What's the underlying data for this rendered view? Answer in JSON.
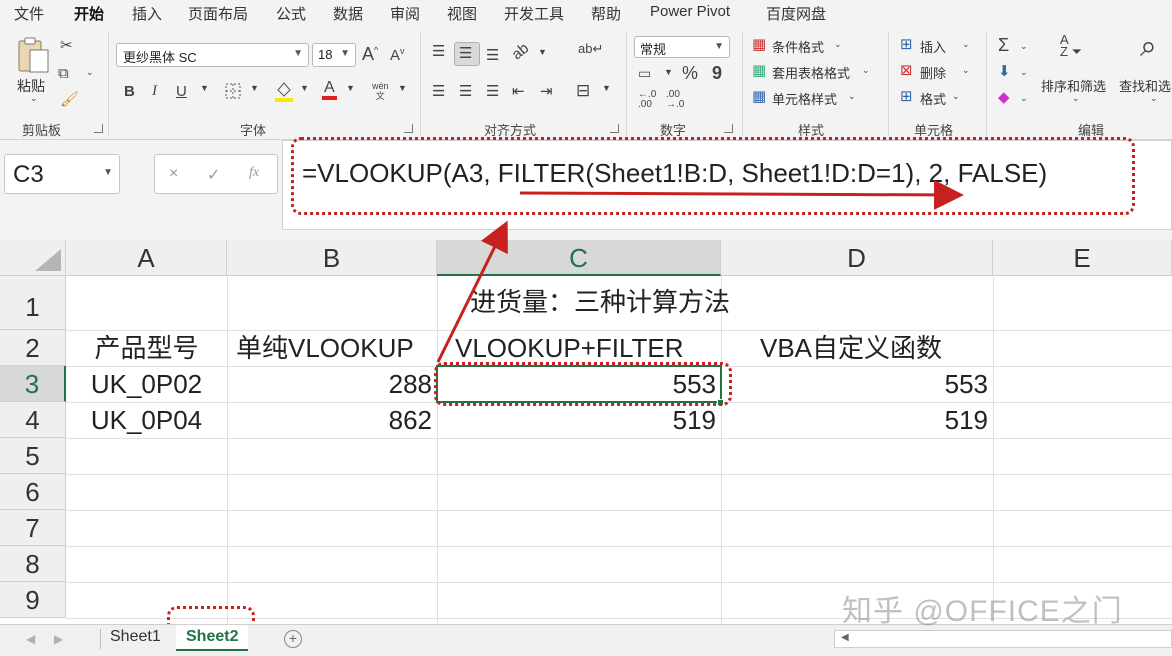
{
  "menu": {
    "tabs": [
      "文件",
      "开始",
      "插入",
      "页面布局",
      "公式",
      "数据",
      "审阅",
      "视图",
      "开发工具",
      "帮助",
      "Power Pivot",
      "百度网盘"
    ],
    "active": "开始"
  },
  "ribbon": {
    "clipboard": {
      "paste_label": "粘贴",
      "group_label": "剪贴板"
    },
    "font": {
      "family": "更纱黑体 SC",
      "size": "18",
      "group_label": "字体",
      "grow": "A",
      "shrink": "A",
      "bold": "B",
      "italic": "I",
      "underline": "U",
      "phonetic": "wén",
      "phonetic_sub": "文"
    },
    "alignment": {
      "group_label": "对齐方式"
    },
    "number": {
      "format": "常规",
      "group_label": "数字",
      "percent": "%",
      "comma": "9"
    },
    "styles": {
      "conditional": "条件格式",
      "table": "套用表格格式",
      "cell": "单元格样式",
      "group_label": "样式"
    },
    "cells": {
      "insert": "插入",
      "delete": "删除",
      "format": "格式",
      "group_label": "单元格"
    },
    "editing": {
      "sort_filter": "排序和筛选",
      "find_select": "查找和选",
      "group_label": "编辑"
    }
  },
  "formula_bar": {
    "name_box": "C3",
    "cancel": "×",
    "enter": "✓",
    "fx": "fx",
    "formula": "=VLOOKUP(A3, FILTER(Sheet1!B:D, Sheet1!D:D=1), 2, FALSE)"
  },
  "grid": {
    "columns": [
      "A",
      "B",
      "C",
      "D",
      "E"
    ],
    "selected_column": "C",
    "rows": [
      "1",
      "2",
      "3",
      "4",
      "5",
      "6",
      "7",
      "8",
      "9"
    ],
    "selected_row": "3",
    "cells": {
      "title": "进货量：三种计算方法",
      "a2": "产品型号",
      "b2": "单纯VLOOKUP",
      "c2": "VLOOKUP+FILTER",
      "d2": "VBA自定义函数",
      "a3": "UK_0P02",
      "b3": "288",
      "c3": "553",
      "d3": "553",
      "a4": "UK_0P04",
      "b4": "862",
      "c4": "519",
      "d4": "519"
    }
  },
  "sheets": {
    "tabs": [
      "Sheet1",
      "Sheet2"
    ],
    "active": "Sheet2",
    "add": "+"
  },
  "watermark": "知乎 @OFFICE之门",
  "colors": {
    "excel_green": "#217346",
    "annotation_red": "#c7211f"
  }
}
